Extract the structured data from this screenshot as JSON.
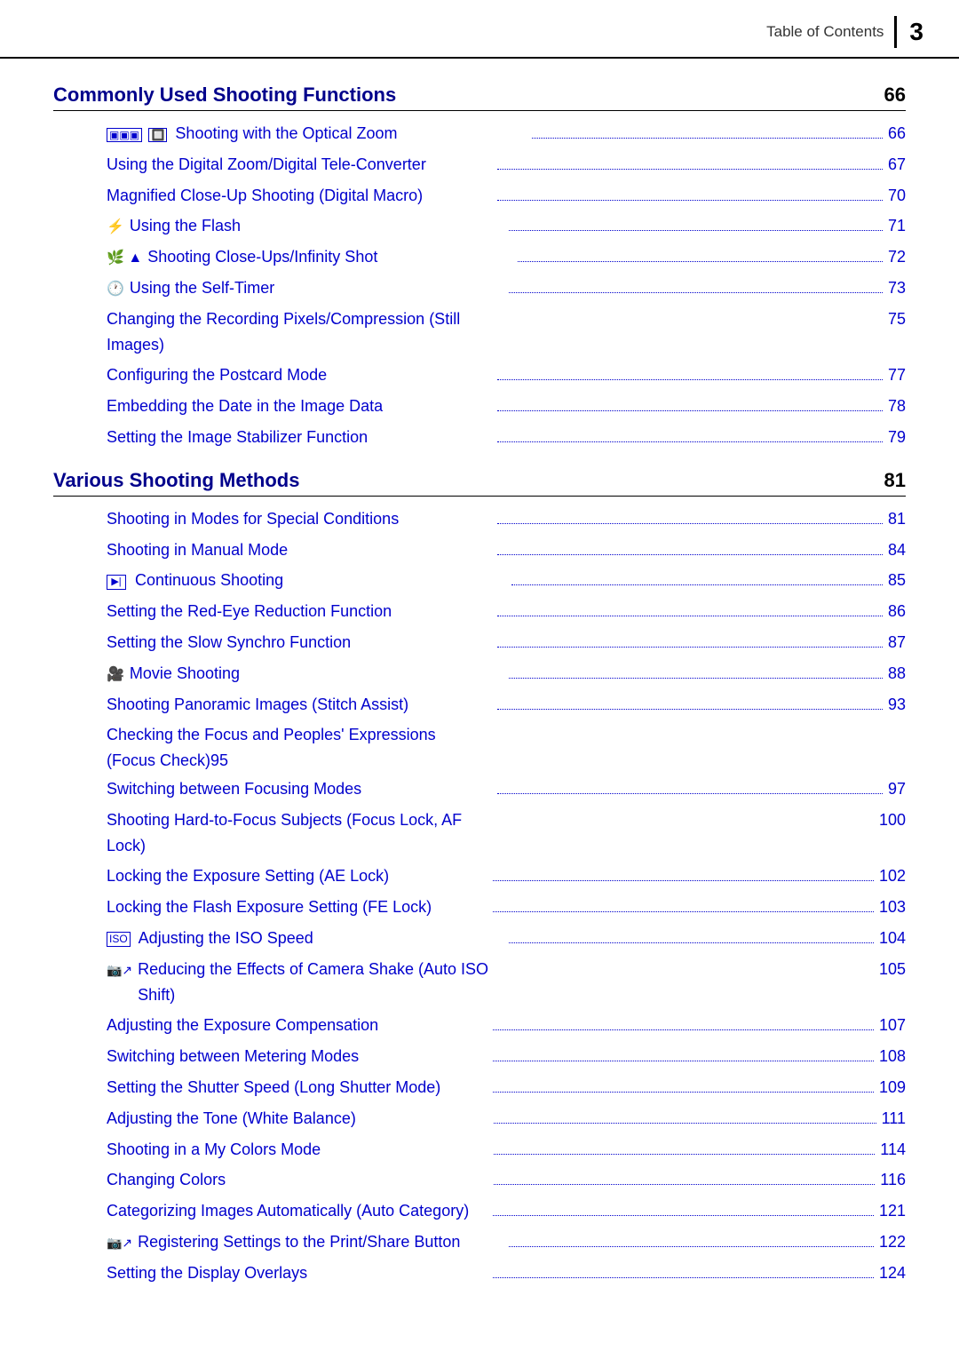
{
  "header": {
    "label": "Table of Contents",
    "divider": true,
    "page_number": "3"
  },
  "sections": [
    {
      "id": "commonly-used",
      "title": "Commonly Used Shooting Functions",
      "page": "66",
      "entries": [
        {
          "icon": "▣ 🔲",
          "text": "Shooting with the Optical Zoom",
          "dots": true,
          "page": "66"
        },
        {
          "icon": "",
          "text": "Using the Digital Zoom/Digital Tele-Converter",
          "dots": true,
          "page": "67"
        },
        {
          "icon": "",
          "text": "Magnified Close-Up Shooting (Digital Macro)",
          "dots": true,
          "page": "70"
        },
        {
          "icon": "⚡",
          "text": "Using the Flash",
          "dots": true,
          "page": "71"
        },
        {
          "icon": "🌿 ▲",
          "text": "Shooting Close-Ups/Infinity Shot",
          "dots": true,
          "page": "72"
        },
        {
          "icon": "🕐",
          "text": "Using the Self-Timer",
          "dots": true,
          "page": "73"
        },
        {
          "icon": "",
          "text": "Changing the Recording Pixels/Compression (Still Images)",
          "dots": false,
          "page": "75"
        },
        {
          "icon": "",
          "text": "Configuring the Postcard Mode",
          "dots": true,
          "page": "77"
        },
        {
          "icon": "",
          "text": "Embedding the Date in the Image Data",
          "dots": true,
          "page": "78"
        },
        {
          "icon": "",
          "text": "Setting the Image Stabilizer Function",
          "dots": true,
          "page": "79"
        }
      ]
    },
    {
      "id": "various-shooting",
      "title": "Various Shooting Methods",
      "page": "81",
      "entries": [
        {
          "icon": "",
          "text": "Shooting in Modes for Special Conditions",
          "dots": true,
          "page": "81"
        },
        {
          "icon": "",
          "text": "Shooting in Manual Mode",
          "dots": true,
          "page": "84"
        },
        {
          "icon": "🔲",
          "text": "Continuous Shooting",
          "dots": true,
          "page": "85"
        },
        {
          "icon": "",
          "text": "Setting the Red-Eye Reduction Function",
          "dots": true,
          "page": "86"
        },
        {
          "icon": "",
          "text": "Setting the Slow Synchro Function",
          "dots": true,
          "page": "87"
        },
        {
          "icon": "🎥",
          "text": "Movie Shooting",
          "dots": true,
          "page": "88"
        },
        {
          "icon": "",
          "text": "Shooting Panoramic Images (Stitch Assist)",
          "dots": true,
          "page": "93"
        },
        {
          "icon": "",
          "text": "Checking the Focus and Peoples' Expressions\n(Focus Check)",
          "dots": true,
          "page": "95",
          "multiline": true
        },
        {
          "icon": "",
          "text": "Switching between Focusing Modes",
          "dots": true,
          "page": "97"
        },
        {
          "icon": "",
          "text": "Shooting Hard-to-Focus Subjects (Focus Lock, AF Lock)",
          "dots": false,
          "page": "100"
        },
        {
          "icon": "",
          "text": "Locking the Exposure Setting (AE Lock)",
          "dots": true,
          "page": "102"
        },
        {
          "icon": "",
          "text": "Locking the Flash Exposure Setting (FE Lock)",
          "dots": true,
          "page": "103"
        },
        {
          "icon": "ISO",
          "text": "Adjusting the ISO Speed",
          "dots": true,
          "page": "104"
        },
        {
          "icon": "📷↗",
          "text": "Reducing the Effects of Camera Shake (Auto ISO Shift)",
          "dots": false,
          "page": "105"
        },
        {
          "icon": "",
          "text": "Adjusting the Exposure Compensation",
          "dots": true,
          "page": "107"
        },
        {
          "icon": "",
          "text": "Switching between Metering Modes",
          "dots": true,
          "page": "108"
        },
        {
          "icon": "",
          "text": "Setting the Shutter Speed (Long Shutter Mode)",
          "dots": true,
          "page": "109"
        },
        {
          "icon": "",
          "text": "Adjusting the Tone (White Balance)",
          "dots": true,
          "page": "111"
        },
        {
          "icon": "",
          "text": "Shooting in a My Colors Mode",
          "dots": true,
          "page": "114"
        },
        {
          "icon": "",
          "text": "Changing Colors",
          "dots": true,
          "page": "116"
        },
        {
          "icon": "",
          "text": "Categorizing Images Automatically (Auto Category)",
          "dots": true,
          "page": "121"
        },
        {
          "icon": "📷↗",
          "text": "Registering Settings to the Print/Share Button",
          "dots": true,
          "page": "122"
        },
        {
          "icon": "",
          "text": "Setting the Display Overlays",
          "dots": true,
          "page": "124"
        }
      ]
    }
  ]
}
